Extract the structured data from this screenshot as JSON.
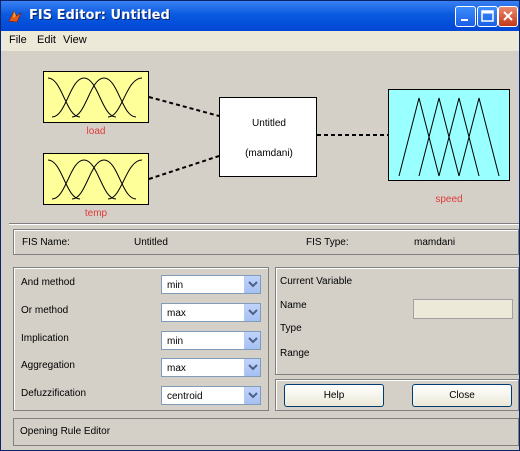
{
  "window": {
    "title": "FIS Editor: Untitled",
    "icon": "matlab-icon"
  },
  "menu": [
    "File",
    "Edit",
    "View"
  ],
  "diagram": {
    "inputs": [
      {
        "label": "load",
        "color": "#ffff99"
      },
      {
        "label": "temp",
        "color": "#ffff99"
      }
    ],
    "system": {
      "name": "Untitled",
      "type": "(mamdani)"
    },
    "output": {
      "label": "speed",
      "color": "#99ffff"
    }
  },
  "fis": {
    "name_label": "FIS Name:",
    "name_value": "Untitled",
    "type_label": "FIS Type:",
    "type_value": "mamdani"
  },
  "methods": [
    {
      "label": "And method",
      "value": "min"
    },
    {
      "label": "Or method",
      "value": "max"
    },
    {
      "label": "Implication",
      "value": "min"
    },
    {
      "label": "Aggregation",
      "value": "max"
    },
    {
      "label": "Defuzzification",
      "value": "centroid"
    }
  ],
  "current_variable": {
    "title": "Current Variable",
    "name_label": "Name",
    "name_value": "",
    "type_label": "Type",
    "range_label": "Range"
  },
  "buttons": {
    "help": "Help",
    "close": "Close"
  },
  "status": "Opening Rule Editor"
}
